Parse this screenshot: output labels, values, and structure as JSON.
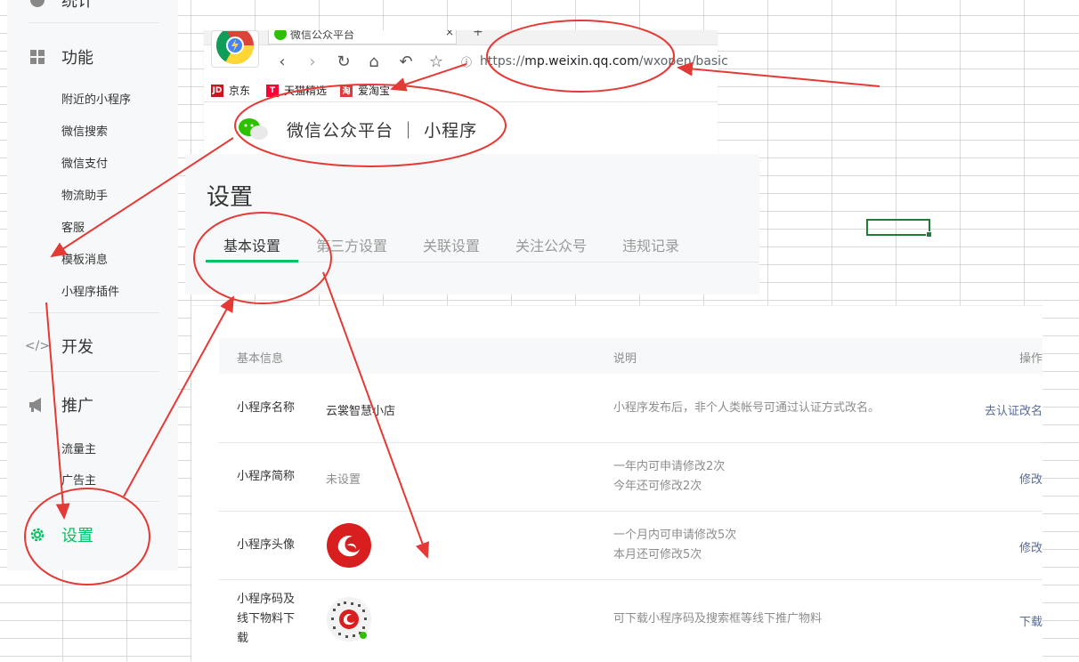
{
  "sidebar": {
    "top_label": "统计",
    "sections": [
      {
        "label": "功能",
        "icon": "grid-icon"
      },
      {
        "label": "开发",
        "icon": "code-icon"
      },
      {
        "label": "推广",
        "icon": "megaphone-icon"
      },
      {
        "label": "设置",
        "icon": "gear-icon"
      }
    ],
    "feature_items": [
      "附近的小程序",
      "微信搜索",
      "微信支付",
      "物流助手",
      "客服",
      "模板消息",
      "小程序插件"
    ],
    "promo_items": [
      "流量主",
      "广告主"
    ]
  },
  "browser": {
    "tab_title": "微信公众平台",
    "tab_close": "×",
    "tab_new": "+",
    "url_scheme": "https://",
    "url_host": "mp.weixin.qq.com",
    "url_path": "/wxopen/basic",
    "bookmarks": [
      {
        "label": "京东",
        "icon": "JD",
        "color": "#c81623"
      },
      {
        "label": "天猫精选",
        "icon": "T",
        "color": "#ff0036"
      },
      {
        "label": "爱淘宝",
        "icon": "淘",
        "color": "#e4393c"
      }
    ]
  },
  "mp_header": {
    "title": "微信公众平台 ｜ 小程序"
  },
  "settings": {
    "title": "设置",
    "tabs": [
      "基本设置",
      "第三方设置",
      "关联设置",
      "关注公众号",
      "违规记录"
    ]
  },
  "table": {
    "headers": {
      "info": "基本信息",
      "desc": "说明",
      "op": "操作"
    },
    "rows": [
      {
        "label": "小程序名称",
        "value": "云裳智慧小店",
        "desc": [
          "小程序发布后，非个人类帐号可通过认证方式改名。"
        ],
        "op": "去认证改名"
      },
      {
        "label": "小程序简称",
        "value": "未设置",
        "desc": [
          "一年内可申请修改2次",
          "今年还可修改2次"
        ],
        "op": "修改"
      },
      {
        "label": "小程序头像",
        "value": "",
        "desc": [
          "一个月内可申请修改5次",
          "本月还可修改5次"
        ],
        "op": "修改"
      },
      {
        "label": "小程序码及线下物料下载",
        "value": "",
        "desc": [
          "可下载小程序码及搜索框等线下推广物料"
        ],
        "op": "下载"
      }
    ]
  },
  "colors": {
    "accent": "#07c160",
    "link": "#576b95",
    "annotation": "#e53935"
  }
}
